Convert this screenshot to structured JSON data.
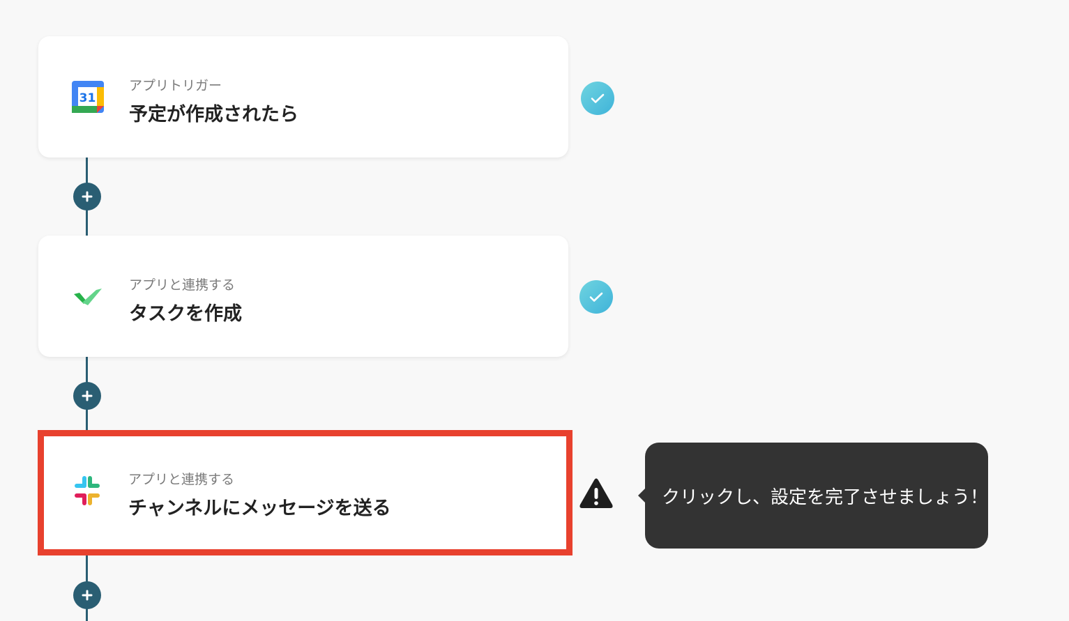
{
  "steps": [
    {
      "kind": "アプリトリガー",
      "name": "予定が作成されたら",
      "icon": "google-calendar-icon",
      "icon_text": "31",
      "status": "complete"
    },
    {
      "kind": "アプリと連携する",
      "name": "タスクを作成",
      "icon": "green-check-app-icon",
      "status": "complete"
    },
    {
      "kind": "アプリと連携する",
      "name": "チャンネルにメッセージを送る",
      "icon": "slack-icon",
      "status": "warning",
      "highlighted": true
    }
  ],
  "tooltip": {
    "text": "クリックし、設定を完了させましょう！"
  },
  "colors": {
    "connector": "#2a5e73",
    "highlight_border": "#e8412e",
    "check_gradient_start": "#6fd4e0",
    "check_gradient_end": "#3fb3d9",
    "tooltip_bg": "#333333"
  }
}
